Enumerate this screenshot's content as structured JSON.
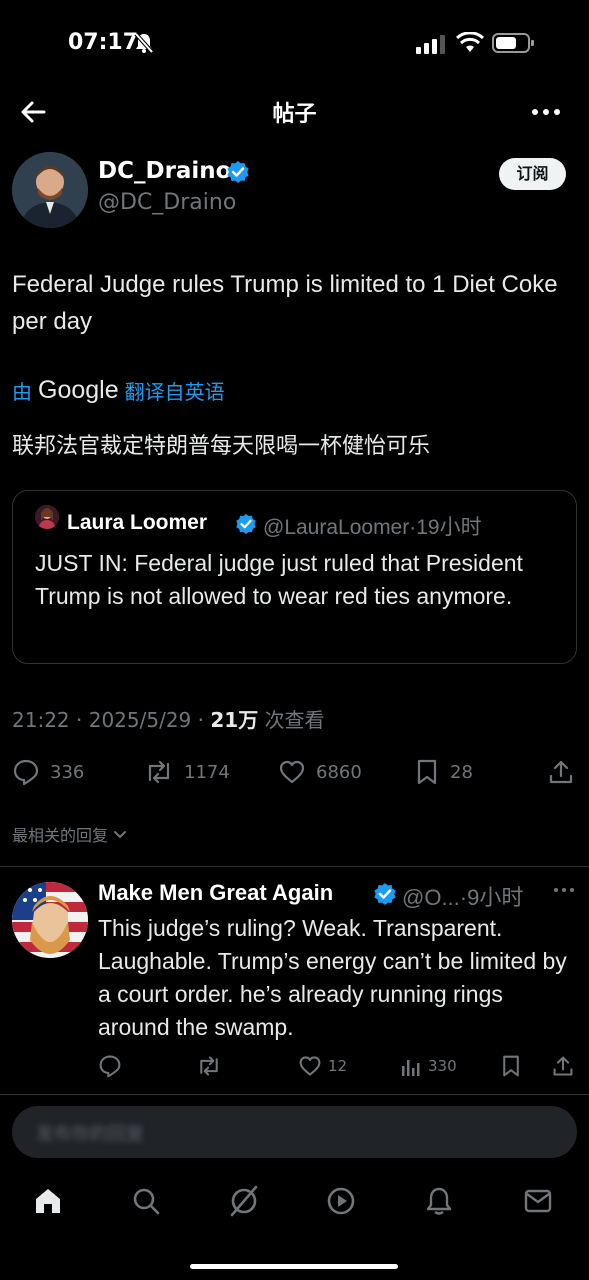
{
  "status_bar": {
    "time": "07:17",
    "icons": [
      "bell-muted-icon",
      "cellular-signal-icon",
      "wifi-icon",
      "battery-icon"
    ]
  },
  "header": {
    "title": "帖子",
    "back_icon": "arrow-left-icon",
    "more_icon": "more-horizontal-icon"
  },
  "post": {
    "author_name": "DC_Draino",
    "author_handle": "@DC_Draino",
    "verified": true,
    "subscribe_label": "订阅",
    "text": "Federal Judge rules Trump is limited to 1 Diet Coke per day",
    "translation": {
      "prefix": "由",
      "provider": "Google",
      "suffix": "翻译自英语",
      "translated_text": "联邦法官裁定特朗普每天限喝一杯健怡可乐"
    },
    "quote": {
      "author_name": "Laura Loomer",
      "author_handle": "@LauraLoomer",
      "time": "19小时",
      "verified": true,
      "text": "JUST IN: Federal judge just ruled that President Trump is not allowed to wear red ties anymore."
    },
    "meta": {
      "time": "21:22",
      "date": "2025/5/29",
      "views": "21万",
      "views_label": "次查看"
    },
    "actions": {
      "replies": "336",
      "reposts": "1174",
      "likes": "6860",
      "bookmarks": "28"
    }
  },
  "replies_filter": {
    "label": "最相关的回复"
  },
  "reply": {
    "author_name": "Make Men Great Again",
    "author_handle": "@O...",
    "time": "9小时",
    "verified": true,
    "text": "This judge’s ruling? Weak. Transparent. Laughable. Trump’s energy can’t be limited by a court order. he’s already running rings around the swamp.",
    "actions": {
      "likes": "12",
      "views": "330"
    }
  },
  "composer": {
    "placeholder": "发布你的回复"
  },
  "bottom_nav": {
    "items": [
      "home-icon",
      "search-icon",
      "grok-icon",
      "video-icon",
      "notifications-icon",
      "messages-icon"
    ],
    "active": "home-icon"
  },
  "colors": {
    "background": "#000000",
    "text": "#e7e9ea",
    "muted": "#71767b",
    "accent": "#1d9bf0",
    "border": "#2f3336"
  }
}
